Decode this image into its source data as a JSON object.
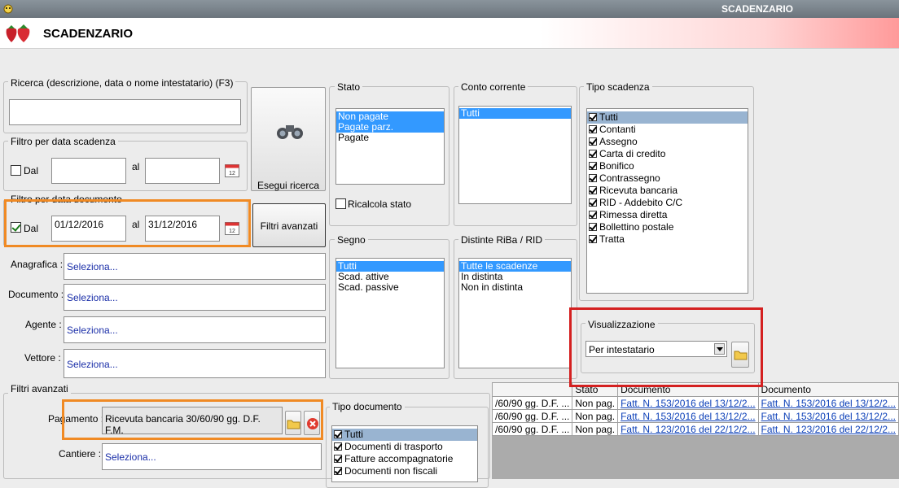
{
  "window": {
    "title": "SCADENZARIO"
  },
  "header": {
    "title": "SCADENZARIO"
  },
  "ricerca": {
    "label": "Ricerca (descrizione, data o nome intestatario) (F3)",
    "value": ""
  },
  "buttons": {
    "esegui": "Esegui ricerca",
    "filtri": "Filtri avanzati"
  },
  "filtro_scadenza": {
    "label": "Filtro per data scadenza",
    "dal_label": "Dal",
    "al_label": "al",
    "from": "",
    "to": "",
    "checked": false
  },
  "filtro_documento": {
    "label": "Filtro per data documento",
    "dal_label": "Dal",
    "al_label": "al",
    "from": "01/12/2016",
    "to": "31/12/2016",
    "checked": true
  },
  "fields": [
    {
      "label": "Anagrafica :",
      "value": "Seleziona..."
    },
    {
      "label": "Documento :",
      "value": "Seleziona..."
    },
    {
      "label": "Agente :",
      "value": "Seleziona..."
    },
    {
      "label": "Vettore :",
      "value": "Seleziona..."
    }
  ],
  "stato": {
    "label": "Stato",
    "items": [
      "Non pagate",
      "Pagate parz.",
      "Pagate"
    ],
    "ricalcola": "Ricalcola stato"
  },
  "conto": {
    "label": "Conto corrente",
    "items": [
      "Tutti"
    ]
  },
  "tipo_scadenza": {
    "label": "Tipo scadenza",
    "items": [
      "Tutti",
      "Contanti",
      "Assegno",
      "Carta di credito",
      "Bonifico",
      "Contrassegno",
      "Ricevuta bancaria",
      "RID - Addebito C/C",
      "Rimessa diretta",
      "Bollettino postale",
      "Tratta"
    ]
  },
  "segno": {
    "label": "Segno",
    "items": [
      "Tutti",
      "Scad. attive",
      "Scad. passive"
    ]
  },
  "distinte": {
    "label": "Distinte RiBa / RID",
    "items": [
      "Tutte le scadenze",
      "In distinta",
      "Non in distinta"
    ]
  },
  "visualizzazione": {
    "label": "Visualizzazione",
    "value": "Per intestatario"
  },
  "filtri_avanzati": {
    "label": "Filtri avanzati",
    "pagamento_label": "Pagamento :",
    "pagamento_value": "Ricevuta bancaria 30/60/90 gg. D.F. F.M.",
    "cantiere_label": "Cantiere :",
    "cantiere_value": "Seleziona..."
  },
  "tipo_documento": {
    "label": "Tipo documento",
    "items": [
      "Tutti",
      "Documenti di trasporto",
      "Fatture accompagnatorie",
      "Documenti non fiscali"
    ]
  },
  "grid": {
    "headers": [
      "",
      "Stato",
      "Documento",
      "Documento"
    ],
    "rows": [
      [
        "/60/90 gg. D.F. ...",
        "Non pag.",
        "Fatt. N. 153/2016 del 13/12/2...",
        "Fatt. N. 153/2016 del 13/12/2..."
      ],
      [
        "/60/90 gg. D.F. ...",
        "Non pag.",
        "Fatt. N. 153/2016 del 13/12/2...",
        "Fatt. N. 153/2016 del 13/12/2..."
      ],
      [
        "/60/90 gg. D.F. ...",
        "Non pag.",
        "Fatt. N. 123/2016 del 22/12/2...",
        "Fatt. N. 123/2016 del 22/12/2..."
      ]
    ]
  },
  "colors": {
    "highlight_orange": "#f08a24",
    "highlight_red": "#d42020",
    "selection": "#3399ff"
  }
}
